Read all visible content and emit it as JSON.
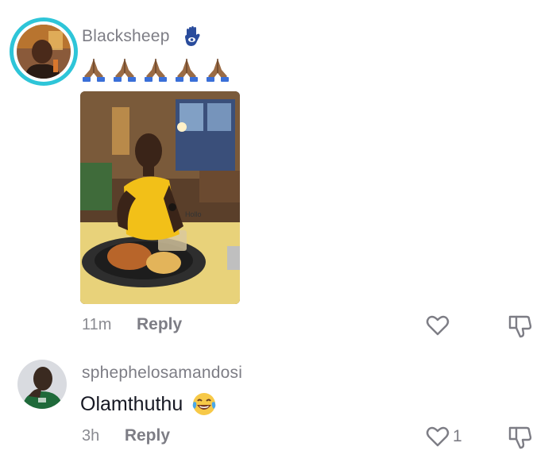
{
  "comments": [
    {
      "username": "Blacksheep",
      "badge_icon": "hamsa-hand-icon",
      "text_emoji": [
        "folded-hands-icon",
        "folded-hands-icon",
        "folded-hands-icon",
        "folded-hands-icon",
        "folded-hands-icon"
      ],
      "has_photo": true,
      "time": "11m",
      "reply_label": "Reply",
      "likes": "",
      "avatar_ring_color": "#2ec5d8"
    },
    {
      "username": "sphephelosamandosi",
      "text": "Olamthuthu",
      "text_emoji": [
        "tears-of-joy-icon"
      ],
      "time": "3h",
      "reply_label": "Reply",
      "likes": "1"
    }
  ],
  "colors": {
    "username": "#7d7d85",
    "text": "#161823",
    "meta": "#8a8b91",
    "icon": "#7d7d85"
  }
}
